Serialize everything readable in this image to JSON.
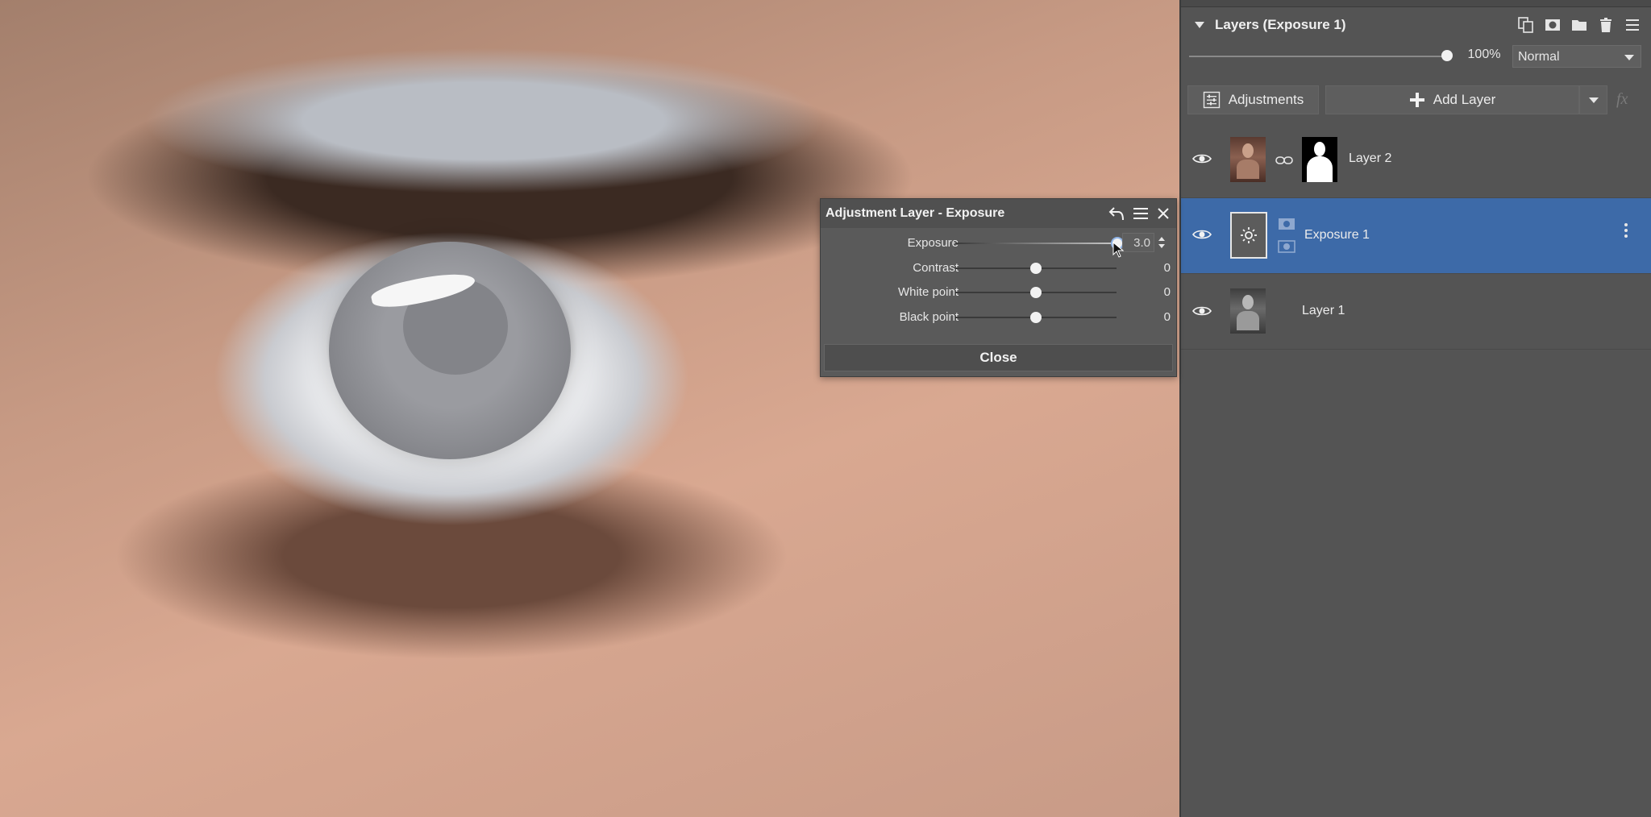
{
  "layers_panel": {
    "title": "Layers (Exposure 1)",
    "header_icons": [
      "copy-layer-icon",
      "mask-icon",
      "folder-icon",
      "trash-icon",
      "menu-icon"
    ],
    "opacity": "100%",
    "opacity_fraction": 1.0,
    "blend_mode": "Normal",
    "adjustments_label": "Adjustments",
    "add_layer_label": "Add Layer",
    "fx_label": "fx",
    "layers": [
      {
        "name": "Layer 2",
        "selected": false,
        "icon": "portrait-thumbnail"
      },
      {
        "name": "Exposure 1",
        "selected": true,
        "icon": "sun-icon"
      },
      {
        "name": "Layer 1",
        "selected": false,
        "icon": "portrait-thumbnail"
      }
    ]
  },
  "dialog": {
    "title": "Adjustment Layer - Exposure",
    "sliders": [
      {
        "label": "Exposure",
        "value": "3.0",
        "fraction": 1.0
      },
      {
        "label": "Contrast",
        "value": "0",
        "fraction": 0.5
      },
      {
        "label": "White point",
        "value": "0",
        "fraction": 0.5
      },
      {
        "label": "Black point",
        "value": "0",
        "fraction": 0.5
      }
    ],
    "close_label": "Close"
  },
  "colors": {
    "selected_row": "#3d6aa8",
    "panel_bg": "#545454"
  }
}
